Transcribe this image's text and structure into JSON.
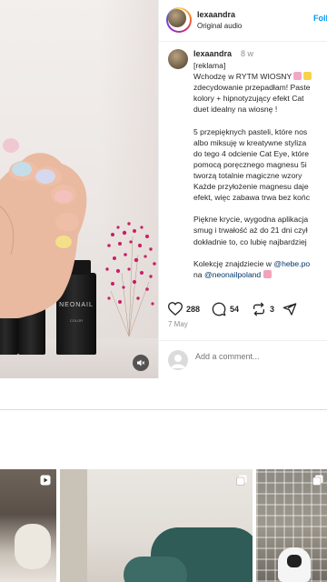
{
  "post": {
    "username": "lexaandra",
    "audio": "Original audio",
    "follow_label": "Foll",
    "caption": {
      "username": "lexaandra",
      "time": "8 w",
      "lines": [
        "[reklama]",
        "Wchodzę w RYTM WIOSNY",
        "zdecydowanie przepadłam! Paste",
        "kolory + hipnotyzujący efekt Cat",
        "duet idealny na wiosnę !",
        "",
        "5 przepięknych pasteli, które nos",
        "albo miksuję w kreatywne styliza",
        "do tego 4 odcienie Cat Eye, które",
        "pomocą poręcznego magnesu 5i",
        "tworzą totalnie magiczne wzory",
        "Każde przyłożenie magnesu daje",
        "efekt, więc zabawa trwa bez końc",
        "",
        "Piękne krycie, wygodna aplikacja",
        "smug i trwałość aż do 21 dni czył",
        "dokładnie to, co lubię najbardziej",
        ""
      ],
      "shop_prefix": "Kolekcję znajdziecie w ",
      "shop_link": "@hebe.po",
      "shop_line2_prefix": "na ",
      "shop_link2": "@neonailpoland"
    },
    "likes": "288",
    "comments": "54",
    "shares": "3",
    "date": "7 May",
    "comment_placeholder": "Add a comment..."
  },
  "media": {
    "bottle_brand": "NEONAIL",
    "bottle_sub": "COLOR"
  },
  "colors": {
    "accent": "#0095f6",
    "link": "#00376b",
    "text": "#262626",
    "muted": "#8e8e8e"
  }
}
